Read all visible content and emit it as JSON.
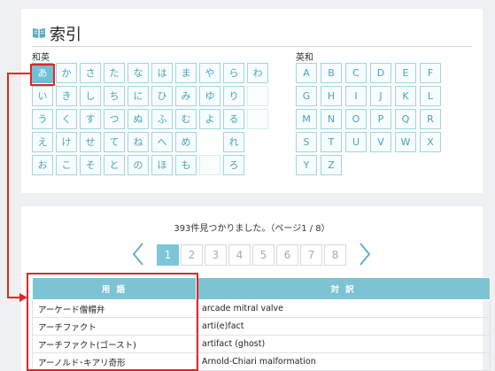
{
  "index": {
    "title": "索引",
    "wa_label": "和英",
    "ei_label": "英和",
    "kana": [
      [
        "あ",
        "か",
        "さ",
        "た",
        "な",
        "は",
        "ま",
        "や",
        "ら",
        "わ"
      ],
      [
        "い",
        "き",
        "し",
        "ち",
        "に",
        "ひ",
        "み",
        "ゆ",
        "り",
        ""
      ],
      [
        "う",
        "く",
        "す",
        "つ",
        "ぬ",
        "ふ",
        "む",
        "よ",
        "る",
        ""
      ],
      [
        "え",
        "け",
        "せ",
        "て",
        "ね",
        "へ",
        "め",
        "",
        "れ",
        ""
      ],
      [
        "お",
        "こ",
        "そ",
        "と",
        "の",
        "ほ",
        "も",
        "",
        "ろ",
        ""
      ]
    ],
    "kana_empty_boxes": [
      [
        1,
        9
      ],
      [
        2,
        9
      ],
      [
        4,
        7
      ]
    ],
    "selected_kana": "あ",
    "alpha": [
      [
        "A",
        "B",
        "C",
        "D",
        "E",
        "F"
      ],
      [
        "G",
        "H",
        "I",
        "J",
        "K",
        "L"
      ],
      [
        "M",
        "N",
        "O",
        "P",
        "Q",
        "R"
      ],
      [
        "S",
        "T",
        "U",
        "V",
        "W",
        "X"
      ],
      [
        "Y",
        "Z"
      ]
    ]
  },
  "results": {
    "status": "393件見つかりました。（ページ1 / 8）",
    "pages": [
      "1",
      "2",
      "3",
      "4",
      "5",
      "6",
      "7",
      "8"
    ],
    "current_page": "1",
    "columns": [
      "用 語",
      "対 訳"
    ],
    "rows": [
      [
        "アーケード僧帽弁",
        "arcade mitral valve"
      ],
      [
        "アーチファクト",
        "arti(e)fact"
      ],
      [
        "アーチファクト(ゴースト)",
        "artifact (ghost)"
      ],
      [
        "アーノルド･キアリ奇形",
        "Arnold-Chiari malformation"
      ]
    ]
  },
  "colors": {
    "accent": "#7cc3d3",
    "highlight": "#e0262a"
  }
}
